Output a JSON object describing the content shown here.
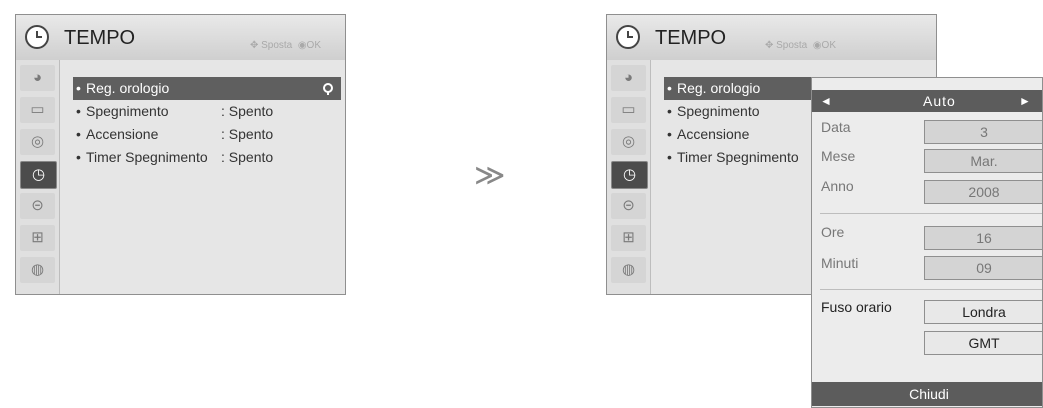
{
  "left_menu": {
    "title": "TEMPO",
    "hint_move": "Sposta",
    "hint_ok": "OK",
    "items": [
      {
        "label": "Reg. orologio",
        "value": ""
      },
      {
        "label": "Spegnimento",
        "value": ": Spento"
      },
      {
        "label": "Accensione",
        "value": ": Spento"
      },
      {
        "label": "Timer Spegnimento",
        "value": ": Spento"
      }
    ]
  },
  "separator": "≫",
  "right_menu": {
    "title": "TEMPO",
    "hint_move": "Sposta",
    "hint_ok": "OK",
    "items": [
      {
        "label": "Reg. orologio"
      },
      {
        "label": "Spegnimento"
      },
      {
        "label": "Accensione"
      },
      {
        "label": "Timer Spegnimento"
      }
    ]
  },
  "popup": {
    "mode_left_arrow": "◄",
    "mode": "Auto",
    "mode_right_arrow": "►",
    "date_label": "Data",
    "date_value": "3",
    "month_label": "Mese",
    "month_value": "Mar.",
    "year_label": "Anno",
    "year_value": "2008",
    "hour_label": "Ore",
    "hour_value": "16",
    "minute_label": "Minuti",
    "minute_value": "09",
    "timezone_label": "Fuso orario",
    "timezone_value": "Londra",
    "timezone_offset": "GMT",
    "close_label": "Chiudi"
  },
  "icons": {
    "sidebar": [
      "picture-icon",
      "screen-icon",
      "audio-icon",
      "clock-icon",
      "lock-icon",
      "setup-icon",
      "usb-icon"
    ],
    "nav_hint": "directional-pad-icon",
    "ok_hint": "ok-button-icon"
  },
  "colors": {
    "header_gradient_top": "#e9e9e9",
    "selected_row": "#5f5f5f",
    "active_sidebar": "#4c4c4c"
  }
}
